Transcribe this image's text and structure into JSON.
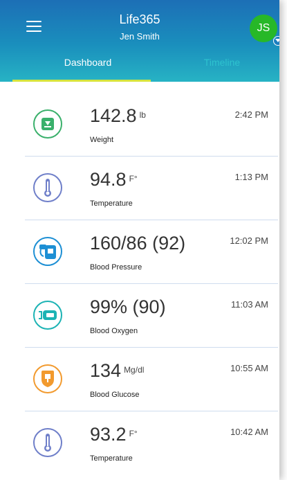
{
  "header": {
    "app_title": "Life365",
    "user_name": "Jen Smith",
    "avatar_initials": "JS"
  },
  "tabs": [
    {
      "label": "Dashboard",
      "active": true
    },
    {
      "label": "Timeline",
      "active": false
    }
  ],
  "readings": [
    {
      "value": "142.8",
      "unit": "lb",
      "label": "Weight",
      "time": "2:42 PM",
      "icon": "scale-icon",
      "color": "#3ab06b"
    },
    {
      "value": "94.8",
      "unit": "F°",
      "label": "Temperature",
      "time": "1:13 PM",
      "icon": "thermometer-icon",
      "color": "#6f7fc9"
    },
    {
      "value": "160/86 (92)",
      "unit": "",
      "label": "Blood Pressure",
      "time": "12:02 PM",
      "icon": "blood-pressure-monitor-icon",
      "color": "#1d8fd4"
    },
    {
      "value": "99% (90)",
      "unit": "",
      "label": "Blood Oxygen",
      "time": "11:03 AM",
      "icon": "pulse-oximeter-icon",
      "color": "#1cb3b4"
    },
    {
      "value": "134",
      "unit": "Mg/dl",
      "label": "Blood Glucose",
      "time": "10:55 AM",
      "icon": "glucose-meter-icon",
      "color": "#f29a2e"
    },
    {
      "value": "93.2",
      "unit": "F°",
      "label": "Temperature",
      "time": "10:42 AM",
      "icon": "thermometer-icon",
      "color": "#6f7fc9"
    }
  ]
}
